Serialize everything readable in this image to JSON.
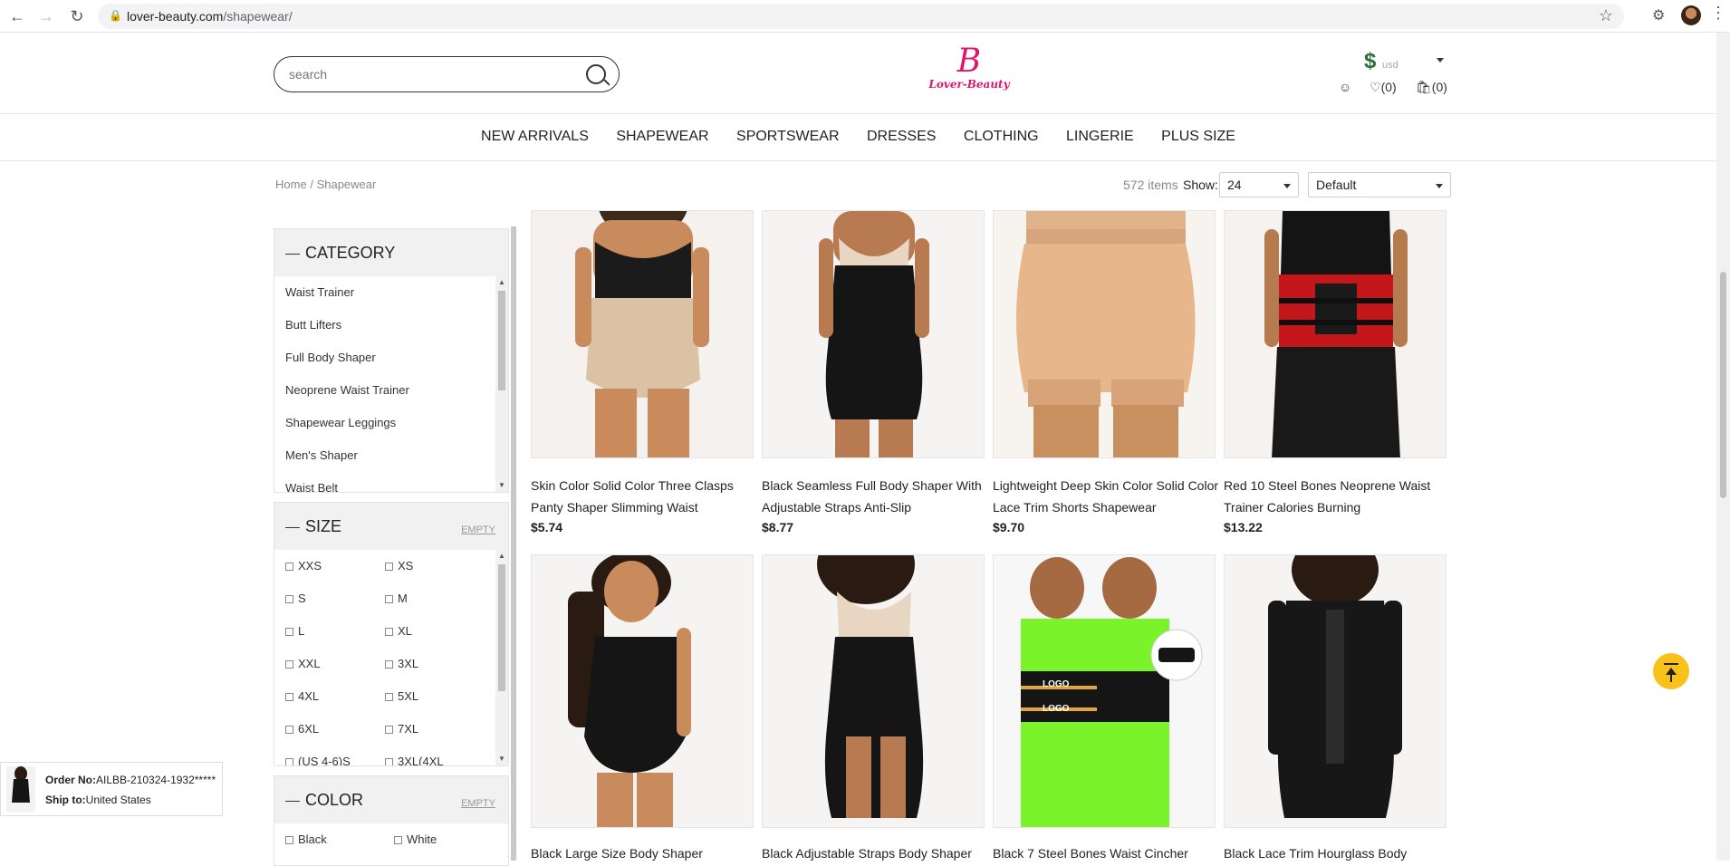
{
  "browser": {
    "url_domain": "lover-beauty.com",
    "url_path": "/shapewear/"
  },
  "header": {
    "search_placeholder": "search",
    "logo_line": "Lover-Beauty",
    "currency_symbol": "$",
    "currency_code": "usd",
    "wishlist_count": "(0)",
    "cart_count": "(0)"
  },
  "nav": [
    "NEW ARRIVALS",
    "SHAPEWEAR",
    "SPORTSWEAR",
    "DRESSES",
    "CLOTHING",
    "LINGERIE",
    "PLUS SIZE"
  ],
  "breadcrumb": {
    "home": "Home",
    "sep": "/",
    "current": "Shapewear"
  },
  "toolbar": {
    "count": "572 items",
    "show_label": "Show:",
    "show_value": "24",
    "sort_value": "Default"
  },
  "filters": {
    "category": {
      "title": "CATEGORY",
      "items": [
        "Waist Trainer",
        "Butt Lifters",
        "Full Body Shaper",
        "Neoprene Waist Trainer",
        "Shapewear Leggings",
        "Men's Shaper",
        "Waist Belt"
      ]
    },
    "size": {
      "title": "SIZE",
      "empty": "EMPTY",
      "items": [
        "XXS",
        "XS",
        "S",
        "M",
        "L",
        "XL",
        "XXL",
        "3XL",
        "4XL",
        "5XL",
        "6XL",
        "7XL",
        "(US 4-6)S",
        "3XL(4XL"
      ]
    },
    "color": {
      "title": "COLOR",
      "empty": "EMPTY",
      "items": [
        "Black",
        "White"
      ]
    }
  },
  "products": [
    {
      "name": "Skin Color Solid Color Three Clasps Panty Shaper Slimming Waist",
      "price": "$5.74"
    },
    {
      "name": "Black Seamless Full Body Shaper With Adjustable Straps Anti-Slip",
      "price": "$8.77"
    },
    {
      "name": "Lightweight Deep Skin Color Solid Color Lace Trim Shorts Shapewear",
      "price": "$9.70"
    },
    {
      "name": "Red 10 Steel Bones Neoprene Waist Trainer Calories Burning",
      "price": "$13.22"
    },
    {
      "name": "Black Large Size Body Shaper",
      "price": ""
    },
    {
      "name": "Black Adjustable Straps Body Shaper",
      "price": ""
    },
    {
      "name": "Black 7 Steel Bones Waist Cincher",
      "price": ""
    },
    {
      "name": "Black Lace Trim Hourglass Body",
      "price": ""
    }
  ],
  "product_labels": [
    "LOGO",
    "LOGO"
  ],
  "order_popup": {
    "order_label": "Order No:",
    "order_value": "AILBB-210324-1932*****",
    "ship_label": "Ship to:",
    "ship_value": "United States"
  },
  "colors": {
    "accent_pink": "#e0156b",
    "back_to_top": "#f8c21a"
  }
}
